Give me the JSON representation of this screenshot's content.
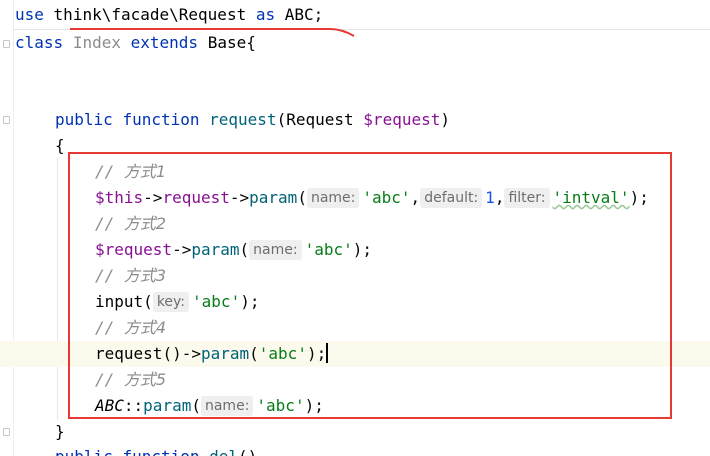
{
  "editor": {
    "lines": {
      "use": {
        "kw_use": "use",
        "path": "think\\facade\\Request",
        "kw_as": "as",
        "alias": "ABC",
        "semi": ";"
      },
      "class": {
        "kw_class": "class",
        "name": "Index",
        "kw_extends": "extends",
        "base": "Base",
        "brace": "{"
      },
      "sig": {
        "kw_public": "public",
        "kw_function": "function",
        "fname": "request",
        "open": "(",
        "ptype": "Request",
        "pvar": "$request",
        "close": ")"
      },
      "open_brace": "{",
      "c1": {
        "slashes": "// ",
        "text": "方式1"
      },
      "l1": {
        "this": "$this",
        "arrow1": "->",
        "prop": "request",
        "arrow2": "->",
        "method": "param",
        "open": "(",
        "hint_name": "name:",
        "arg1": "'abc'",
        "comma1": ",",
        "hint_default": "default:",
        "arg2": "1",
        "comma2": ",",
        "hint_filter": "filter:",
        "arg3": "'intval'",
        "close": ");"
      },
      "c2": {
        "slashes": "// ",
        "text": "方式2"
      },
      "l2": {
        "var": "$request",
        "arrow": "->",
        "method": "param",
        "open": "(",
        "hint_name": "name:",
        "arg1": "'abc'",
        "close": ");"
      },
      "c3": {
        "slashes": "// ",
        "text": "方式3"
      },
      "l3": {
        "fn": "input",
        "open": "(",
        "hint_key": "key:",
        "arg1": "'abc'",
        "close": ");"
      },
      "c4": {
        "slashes": "// ",
        "text": "方式4"
      },
      "l4": {
        "fn": "request",
        "call": "()",
        "arrow": "->",
        "method": "param",
        "open": "(",
        "arg1": "'abc'",
        "close": ");"
      },
      "c5": {
        "slashes": "// ",
        "text": "方式5"
      },
      "l5": {
        "cls": "ABC",
        "dcolon": "::",
        "method": "param",
        "open": "(",
        "hint_name": "name:",
        "arg1": "'abc'",
        "close": ");"
      },
      "close_brace": "}",
      "next": {
        "kw_public": "public",
        "kw_function": "function",
        "fname": "del",
        "parens": "()"
      }
    }
  },
  "annotation_colors": {
    "box": "#e53935",
    "underline": "#e53935"
  }
}
